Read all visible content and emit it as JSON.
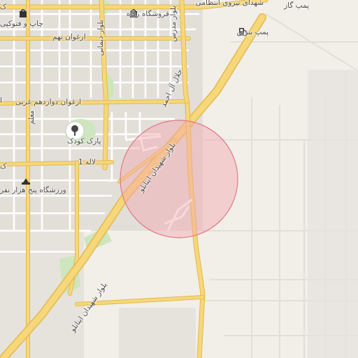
{
  "map": {
    "colors": {
      "background": "#f2efe9",
      "block": "#e2dfd9",
      "minor_road": "#ffffff",
      "major_road": "#f6d77a",
      "major_road_edge": "#e3b94d",
      "park": "#cde6bd",
      "circle_fill": "#f4a6ad",
      "circle_stroke": "#e07a85"
    },
    "labels": {
      "pump_gas": "پمپ گاز",
      "shohada_niroo": "شهدای نیروی انتظامی",
      "store_refah": "فروشگاه رفاه",
      "chap_fotokopi": "چاپ و فتوکپی",
      "pump_benzin": "پمپ بنزین",
      "arghavan_nohom": "ارغوان نهم",
      "bolvar_modares": "بلوار مدرس",
      "bolvar_dimani": "بلوار دیمانی",
      "arghavan_12_gharbi": "ارغوان دوازدهم غربی",
      "jalal_al_ahmad": "جلال آل احمد",
      "park_koodak": "پارک کودک",
      "moallem": "معلم",
      "laleh_1": "لاله 1",
      "varzeshgah": "ورزشگاه پنج هزار نفر",
      "bolvar_shahidan_top": "بلوار شهیدان اینانلو",
      "bolvar_shahidan_bottom": "بلوار شهیدان اینانلو",
      "edge_k": "ک",
      "edge_o": "ا",
      "edge_k2": "ک"
    },
    "icons": {
      "store_refah": "shopping-bag-icon",
      "chap_fotokopi": "shopping-bag-icon",
      "pump_benzin": "fuel-pump-icon",
      "park_koodak": "tree-icon",
      "varzeshgah": "stadium-icon"
    }
  }
}
